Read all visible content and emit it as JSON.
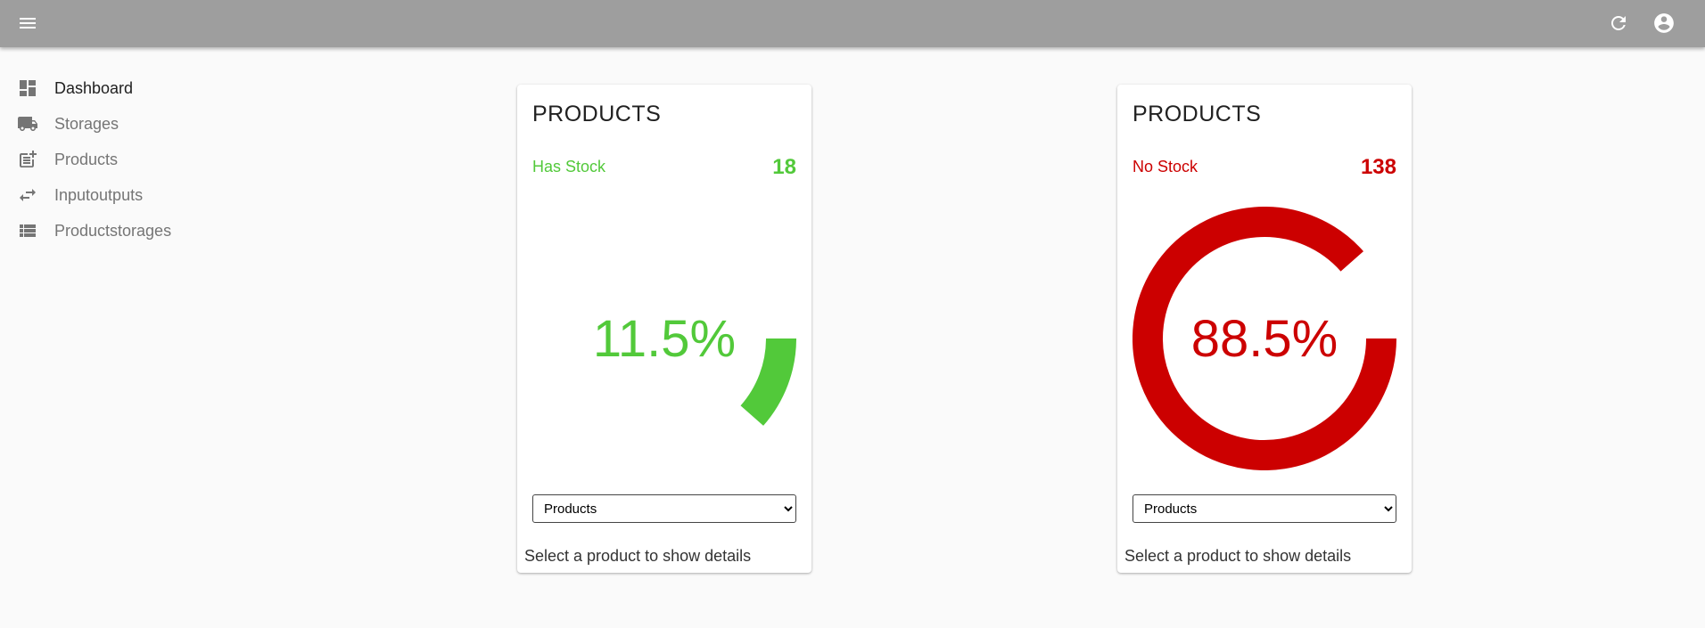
{
  "colors": {
    "topbar": "#9e9e9e",
    "has_stock": "#52c93a",
    "no_stock": "#cc0000"
  },
  "topbar": {
    "menu_icon": "menu-icon",
    "refresh_icon": "refresh-icon",
    "account_icon": "account-circle-icon"
  },
  "sidebar": {
    "items": [
      {
        "label": "Dashboard",
        "icon": "dashboard-icon"
      },
      {
        "label": "Storages",
        "icon": "truck-icon"
      },
      {
        "label": "Products",
        "icon": "post-add-icon"
      },
      {
        "label": "Inputoutputs",
        "icon": "swap-horiz-icon"
      },
      {
        "label": "Productstorages",
        "icon": "list-icon"
      }
    ]
  },
  "cards": [
    {
      "title": "PRODUCTS",
      "stat_label": "Has Stock",
      "stat_value": "18",
      "percent_label": "11.5%",
      "percent": 11.5,
      "select_value": "Products",
      "footer": "Select a product to show details"
    },
    {
      "title": "PRODUCTS",
      "stat_label": "No Stock",
      "stat_value": "138",
      "percent_label": "88.5%",
      "percent": 88.5,
      "select_value": "Products",
      "footer": "Select a product to show details"
    }
  ]
}
